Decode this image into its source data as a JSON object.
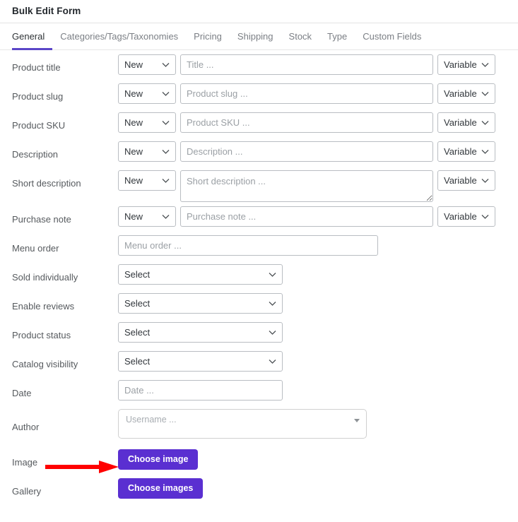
{
  "header": {
    "title": "Bulk Edit Form"
  },
  "tabs": [
    {
      "label": "General",
      "active": true
    },
    {
      "label": "Categories/Tags/Taxonomies",
      "active": false
    },
    {
      "label": "Pricing",
      "active": false
    },
    {
      "label": "Shipping",
      "active": false
    },
    {
      "label": "Stock",
      "active": false
    },
    {
      "label": "Type",
      "active": false
    },
    {
      "label": "Custom Fields",
      "active": false
    }
  ],
  "colors": {
    "accent_purple": "#5b46c8",
    "button_purple": "#5a2fd1",
    "annotation_red": "#ff0000",
    "label_gray": "#565a5e",
    "placeholder_gray": "#9ba0a5",
    "border_gray": "#b9bdc2"
  },
  "fields": {
    "product_title": {
      "label": "Product title",
      "mode_value": "New",
      "placeholder": "Title ...",
      "value": "",
      "scope_value": "Variable"
    },
    "product_slug": {
      "label": "Product slug",
      "mode_value": "New",
      "placeholder": "Product slug ...",
      "value": "",
      "scope_value": "Variable"
    },
    "product_sku": {
      "label": "Product SKU",
      "mode_value": "New",
      "placeholder": "Product SKU ...",
      "value": "",
      "scope_value": "Variable"
    },
    "description": {
      "label": "Description",
      "mode_value": "New",
      "placeholder": "Description ...",
      "value": "",
      "scope_value": "Variable"
    },
    "short_description": {
      "label": "Short description",
      "mode_value": "New",
      "placeholder": "Short description ...",
      "value": "",
      "scope_value": "Variable"
    },
    "purchase_note": {
      "label": "Purchase note",
      "mode_value": "New",
      "placeholder": "Purchase note ...",
      "value": "",
      "scope_value": "Variable"
    },
    "menu_order": {
      "label": "Menu order",
      "placeholder": "Menu order ...",
      "value": ""
    },
    "sold_individually": {
      "label": "Sold individually",
      "select_value": "Select"
    },
    "enable_reviews": {
      "label": "Enable reviews",
      "select_value": "Select"
    },
    "product_status": {
      "label": "Product status",
      "select_value": "Select"
    },
    "catalog_visibility": {
      "label": "Catalog visibility",
      "select_value": "Select"
    },
    "date": {
      "label": "Date",
      "placeholder": "Date ...",
      "value": ""
    },
    "author": {
      "label": "Author",
      "placeholder": "Username ..."
    },
    "image": {
      "label": "Image",
      "button_label": "Choose image"
    },
    "gallery": {
      "label": "Gallery",
      "button_label": "Choose images"
    }
  },
  "annotation": {
    "type": "arrow",
    "direction": "right",
    "points_to": "Choose image"
  }
}
